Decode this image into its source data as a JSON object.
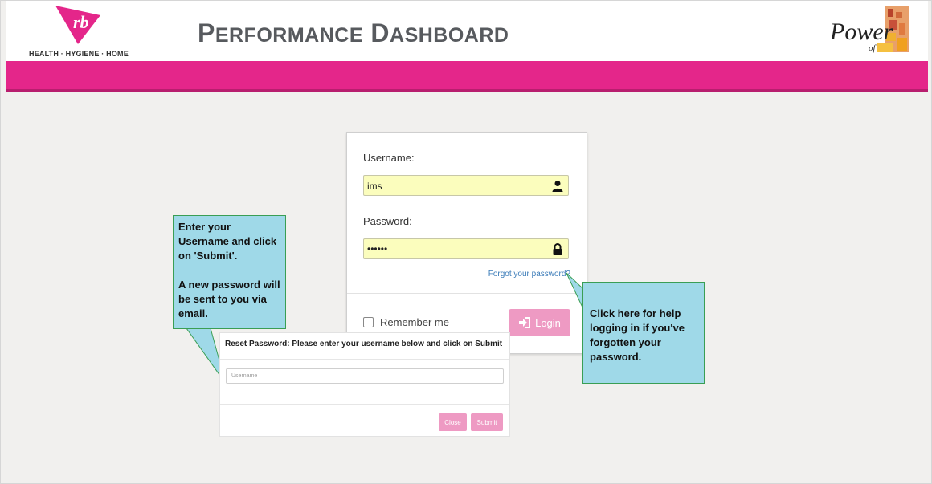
{
  "header": {
    "logo_text": "rb",
    "tagline": "HEALTH · HYGIENE · HOME",
    "title_initial_1": "P",
    "title_rest_1": "ERFORMANCE",
    "title_initial_2": "D",
    "title_rest_2": "ASHBOARD",
    "power_text": "Power",
    "power_sub": "of"
  },
  "login": {
    "username_label": "Username:",
    "username_value": "ims",
    "password_label": "Password:",
    "password_value": "••••••",
    "forgot_link": "Forgot your password?",
    "remember_label": "Remember me",
    "login_button": "Login"
  },
  "callouts": {
    "left_line1": "Enter your Username and click on 'Submit'.",
    "left_line2": "A new password will be sent to you via email.",
    "right": "Click here for help logging in if you've forgotten your password."
  },
  "reset_dialog": {
    "title": "Reset Password: Please enter your username below and click on Submit",
    "placeholder": "Username",
    "close_button": "Close",
    "submit_button": "Submit"
  },
  "colors": {
    "brand_pink": "#e4268a",
    "button_pink": "#ee9ac3",
    "callout_blue": "#9fd9e8",
    "autofill_yellow": "#fbfdbd"
  }
}
